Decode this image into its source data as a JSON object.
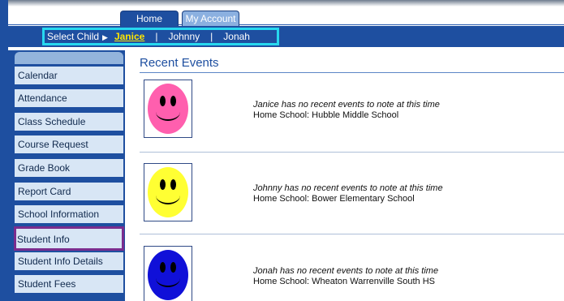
{
  "header": {
    "tabs": [
      {
        "label": "Home",
        "active": true
      },
      {
        "label": "My Account",
        "active": false
      }
    ]
  },
  "child_selector": {
    "label": "Select Child",
    "children": [
      "Janice",
      "Johnny",
      "Jonah"
    ],
    "selected": "Janice",
    "separator": "|"
  },
  "sidebar": {
    "items": [
      {
        "label": "Calendar"
      },
      {
        "label": "Attendance"
      },
      {
        "label": "Class Schedule"
      },
      {
        "label": "Course Request"
      },
      {
        "label": "Grade Book"
      },
      {
        "label": "Report Card"
      },
      {
        "label": "School Information"
      },
      {
        "label": "Student Info",
        "highlighted": true
      },
      {
        "label": "Student Info Details"
      },
      {
        "label": "Student Fees"
      }
    ]
  },
  "main": {
    "title": "Recent Events",
    "events": [
      {
        "message": "Janice has no recent events to note at this time",
        "school": "Home School: Hubble Middle School",
        "avatar_color": "#ff5fae"
      },
      {
        "message": "Johnny has no recent events to note at this time",
        "school": "Home School: Bower Elementary School",
        "avatar_color": "#ffff33"
      },
      {
        "message": "Jonah has no recent events to note at this time",
        "school": "Home School: Wheaton Warrenville South HS",
        "avatar_color": "#1010d8"
      }
    ]
  },
  "colors": {
    "nav_blue": "#1e4fa0",
    "selector_highlight": "#27d8ef",
    "active_child": "#ffe600",
    "sidebar_highlight": "#7b2d8e"
  }
}
